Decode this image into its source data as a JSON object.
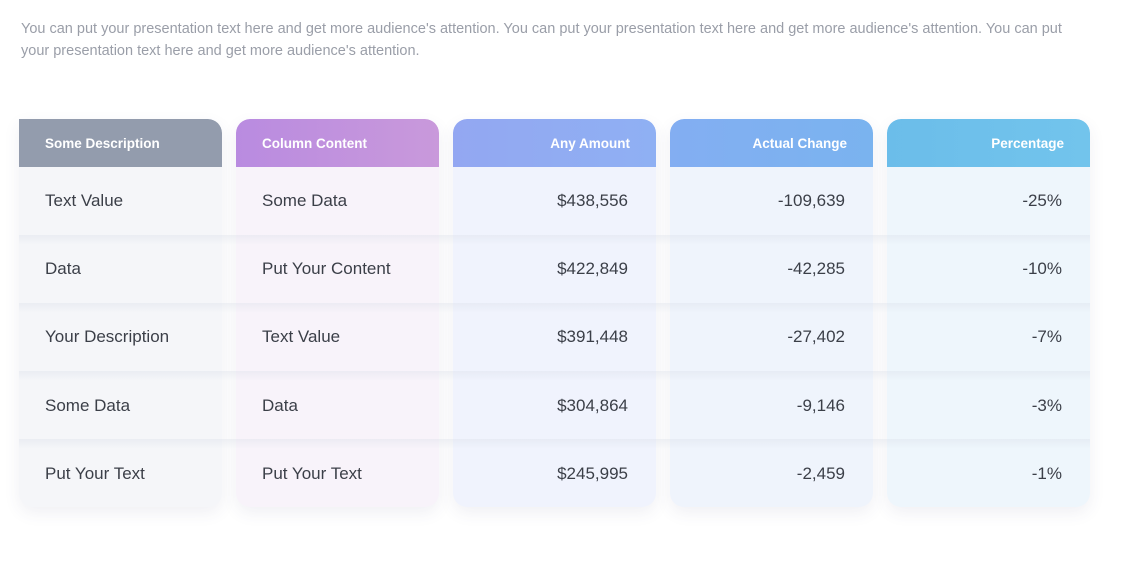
{
  "intro_text": "You can put your presentation text here and get more audience's attention. You can put your presentation text here and get more audience's attention. You can put your presentation text here and get more audience's attention.",
  "table": {
    "headers": [
      "Some Description",
      "Column Content",
      "Any Amount",
      "Actual Change",
      "Percentage"
    ],
    "rows": [
      [
        "Text Value",
        "Some Data",
        "$438,556",
        "-109,639",
        "-25%"
      ],
      [
        "Data",
        "Put Your Content",
        "$422,849",
        "-42,285",
        "-10%"
      ],
      [
        "Your Description",
        "Text Value",
        "$391,448",
        "-27,402",
        "-7%"
      ],
      [
        "Some Data",
        "Data",
        "$304,864",
        "-9,146",
        "-3%"
      ],
      [
        "Put Your Text",
        "Put Your Text",
        "$245,995",
        "-2,459",
        "-1%"
      ]
    ]
  },
  "colors": {
    "header_1": "#939cad",
    "header_2": "#c194de",
    "header_3": "#91abf2",
    "header_4": "#7eb1f0",
    "header_5": "#6fc0eb",
    "text": "#3b3f48",
    "intro_text": "#9a9ea8"
  }
}
